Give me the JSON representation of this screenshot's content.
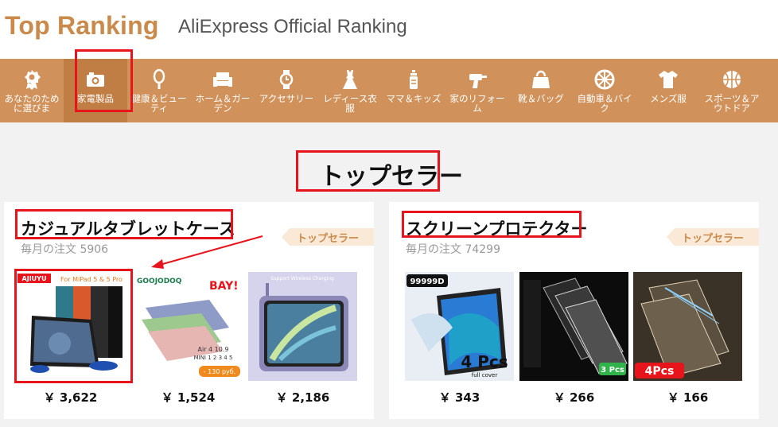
{
  "header": {
    "brand": "Top Ranking",
    "subtitle": "AliExpress Official Ranking"
  },
  "nav": {
    "items": [
      {
        "label": "あなたのために選びま",
        "icon": "medal-icon"
      },
      {
        "label": "家電製品",
        "icon": "camera-icon",
        "active": true
      },
      {
        "label": "健康＆ビューティ",
        "icon": "mirror-icon"
      },
      {
        "label": "ホーム＆ガーデン",
        "icon": "sofa-icon"
      },
      {
        "label": "アクセサリー",
        "icon": "watch-icon"
      },
      {
        "label": "レディース衣服",
        "icon": "dress-icon"
      },
      {
        "label": "ママ＆キッズ",
        "icon": "baby-bottle-icon"
      },
      {
        "label": "家のリフォーム",
        "icon": "drill-icon"
      },
      {
        "label": "靴＆バッグ",
        "icon": "handbag-icon"
      },
      {
        "label": "自動車＆バイク",
        "icon": "wheel-icon"
      },
      {
        "label": "メンズ服",
        "icon": "tshirt-icon"
      },
      {
        "label": "スポーツ＆アウトドア",
        "icon": "basketball-icon"
      }
    ]
  },
  "section": {
    "title": "トップセラー"
  },
  "cards": [
    {
      "title": "カジュアルタブレットケース",
      "orders": "毎月の注文 5906",
      "tag": "トップセラー",
      "products": [
        {
          "price": "￥ 3,622",
          "brand_text": "AJIUYU",
          "banner_text": "For MiPad 5 & 5 Pro"
        },
        {
          "price": "￥ 1,524",
          "brand_text": "GOOJODOQ",
          "promo_text": "BAY!",
          "model_text": "Air 4 10.9",
          "model_text2": "MINI 1 2 3 4 5",
          "discount_text": "- 130 руб."
        },
        {
          "price": "￥ 2,186",
          "banner_text": "Support Wireless Charging"
        }
      ]
    },
    {
      "title": "スクリーンプロテクター",
      "orders": "毎月の注文 74299",
      "tag": "トップセラー",
      "products": [
        {
          "price": "￥ 343",
          "brand_text": "99999D",
          "pcs_text": "4 Pcs",
          "sub_text": "full cover"
        },
        {
          "price": "￥ 266",
          "pcs_text": "3 Pcs"
        },
        {
          "price": "￥ 166",
          "pcs_text": "4Pcs"
        }
      ]
    }
  ],
  "colors": {
    "brand": "#c98a4b",
    "nav_bg": "#d0925a",
    "nav_active": "#c07e45",
    "annotation": "#e8141b",
    "tag_bg": "#fbe9d8"
  }
}
